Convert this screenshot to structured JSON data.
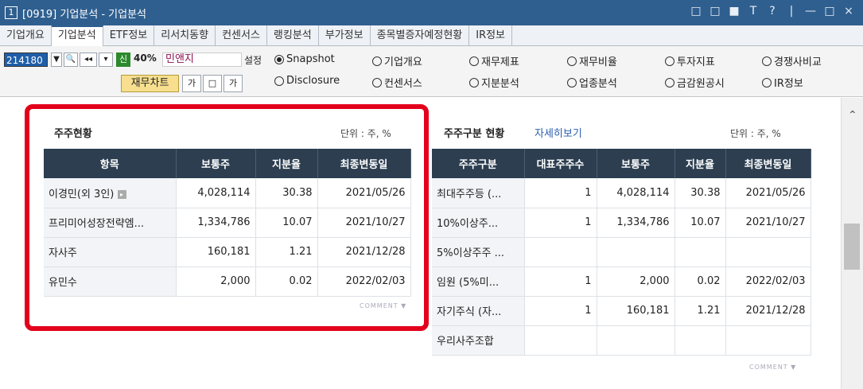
{
  "window": {
    "number": "1",
    "title": "[0919] 기업분석 - 기업분석",
    "controls": [
      "□",
      "□",
      "■",
      "T",
      "?",
      "|",
      "—",
      "□",
      "×"
    ]
  },
  "tabs": [
    "기업개요",
    "기업분석",
    "ETF정보",
    "리서치동향",
    "컨센서스",
    "랭킹분석",
    "부가정보",
    "종목별증자예정현황",
    "IR정보"
  ],
  "active_tab": 1,
  "toolbar": {
    "code": "214180",
    "new_badge": "신",
    "percent": "40%",
    "name": "민앤지",
    "setting": "설정",
    "chart_button": "재무차트",
    "small_buttons": [
      "가",
      "□",
      "가"
    ]
  },
  "radios": [
    {
      "label": "Snapshot",
      "selected": true
    },
    {
      "label": "기업개요",
      "selected": false
    },
    {
      "label": "재무제표",
      "selected": false
    },
    {
      "label": "재무비율",
      "selected": false
    },
    {
      "label": "투자지표",
      "selected": false
    },
    {
      "label": "경쟁사비교",
      "selected": false
    },
    {
      "label": "Disclosure",
      "selected": false
    },
    {
      "label": "컨센서스",
      "selected": false
    },
    {
      "label": "지분분석",
      "selected": false
    },
    {
      "label": "업종분석",
      "selected": false
    },
    {
      "label": "금감원공시",
      "selected": false
    },
    {
      "label": "IR정보",
      "selected": false
    }
  ],
  "left_panel": {
    "title": "주주현황",
    "unit": "단위 : 주, %",
    "headers": [
      "항목",
      "보통주",
      "지분율",
      "최종변동일"
    ],
    "rows": [
      [
        "이경민(외 3인)",
        "4,028,114",
        "30.38",
        "2021/05/26"
      ],
      [
        "프리미어성장전략엠...",
        "1,334,786",
        "10.07",
        "2021/10/27"
      ],
      [
        "자사주",
        "160,181",
        "1.21",
        "2021/12/28"
      ],
      [
        "유민수",
        "2,000",
        "0.02",
        "2022/02/03"
      ]
    ],
    "comment": "COMMENT"
  },
  "right_panel": {
    "title": "주주구분 현황",
    "link": "자세히보기",
    "unit": "단위 : 주, %",
    "headers": [
      "주주구분",
      "대표주주수",
      "보통주",
      "지분율",
      "최종변동일"
    ],
    "rows": [
      [
        "최대주주등 (...",
        "1",
        "4,028,114",
        "30.38",
        "2021/05/26"
      ],
      [
        "10%이상주...",
        "1",
        "1,334,786",
        "10.07",
        "2021/10/27"
      ],
      [
        "5%이상주주 ...",
        "",
        "",
        "",
        ""
      ],
      [
        "임원 (5%미...",
        "1",
        "2,000",
        "0.02",
        "2022/02/03"
      ],
      [
        "자기주식 (자...",
        "1",
        "160,181",
        "1.21",
        "2021/12/28"
      ],
      [
        "우리사주조합",
        "",
        "",
        "",
        ""
      ]
    ],
    "comment": "COMMENT"
  },
  "colors": {
    "titlebar": "#2f5f8f",
    "table_header": "#2c3e50",
    "highlight_frame": "#e3001b"
  }
}
